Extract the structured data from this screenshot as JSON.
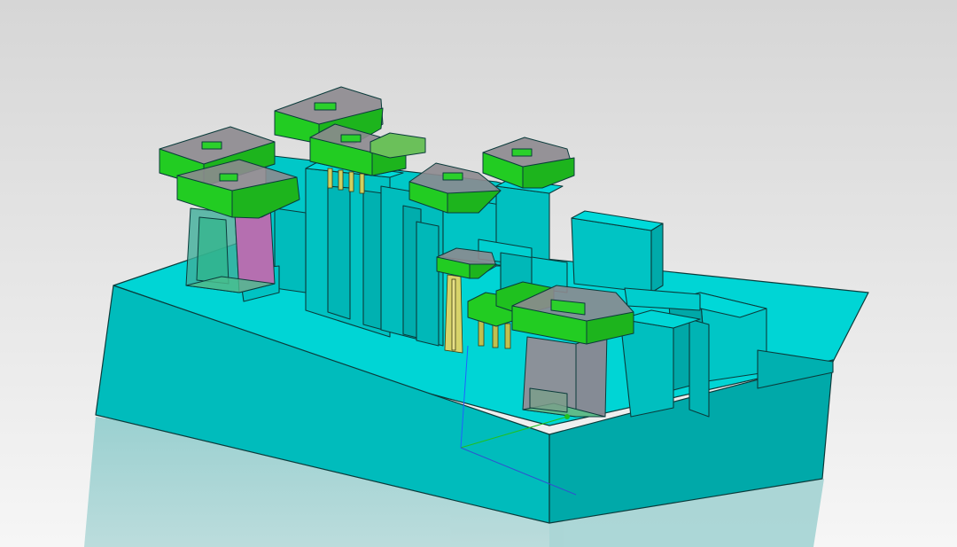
{
  "viewer": {
    "render_mode": "shaded-with-edges",
    "background": {
      "top": "#dcdcdc",
      "bottom": "#f7f7f7"
    },
    "floor_reflection": true
  },
  "colors": {
    "body": "#00cccc",
    "body_face_top": "#00d7d7",
    "body_face_front": "#00bebe",
    "body_face_side": "#00a8a8",
    "edge": "#0b3b3b",
    "cap": "#22cc22",
    "cap_face_side": "#1aa51a",
    "transparent_wall": "#8f8f92",
    "magenta_insert": "#b56fb0",
    "pin": "#c8c850",
    "axis_x": "#20c020",
    "axis_y": "#2060ff",
    "axis_z": "#aa3344"
  },
  "model": {
    "base_block": {
      "name": "mold-base"
    },
    "components": [
      {
        "name": "cavity-insert-left",
        "material": "transparent"
      },
      {
        "name": "cavity-insert-right",
        "material": "transparent"
      },
      {
        "name": "connector-cap-1",
        "material": "green"
      },
      {
        "name": "connector-cap-2",
        "material": "green"
      },
      {
        "name": "connector-cap-3",
        "material": "green"
      },
      {
        "name": "connector-cap-4",
        "material": "green"
      },
      {
        "name": "connector-cap-5",
        "material": "green"
      },
      {
        "name": "connector-cap-6",
        "material": "green"
      },
      {
        "name": "connector-cap-7",
        "material": "green"
      },
      {
        "name": "connector-cap-8",
        "material": "green"
      }
    ]
  },
  "triad": {
    "visible": true,
    "style": "world-axes"
  }
}
